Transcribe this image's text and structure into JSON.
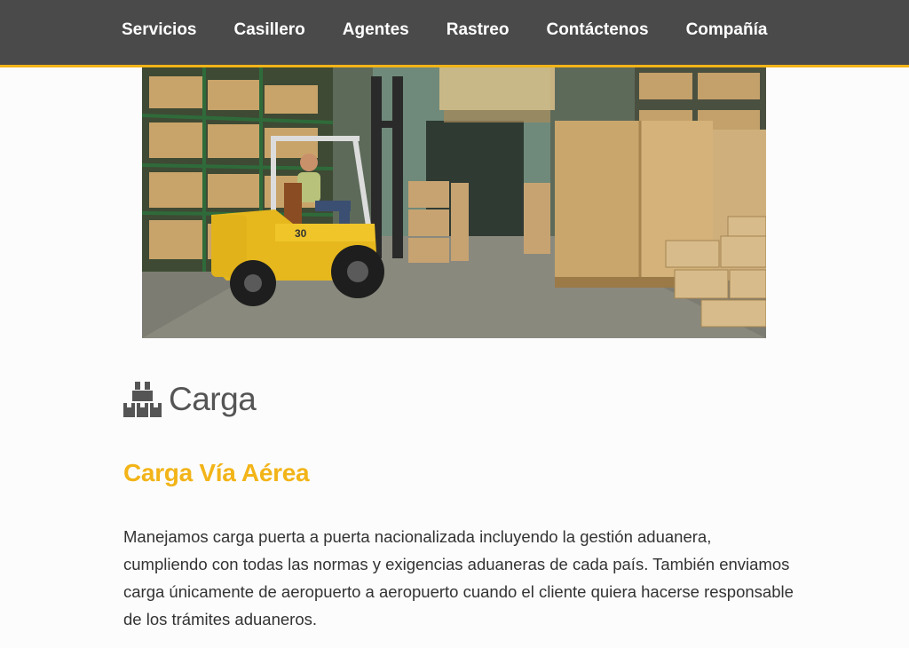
{
  "nav": {
    "items": [
      {
        "label": "Servicios"
      },
      {
        "label": "Casillero"
      },
      {
        "label": "Agentes"
      },
      {
        "label": "Rastreo"
      },
      {
        "label": "Contáctenos"
      },
      {
        "label": "Compañía"
      }
    ]
  },
  "hero": {
    "image_description_icon": "warehouse-forklift-photo",
    "forklift_number": "30"
  },
  "section": {
    "icon": "boxes-icon",
    "title": "Carga"
  },
  "service": {
    "title": "Carga Vía Aérea",
    "description": "Manejamos carga puerta a puerta nacionalizada incluyendo la gestión aduanera, cumpliendo con todas las normas y exigencias aduaneras de cada país. También enviamos carga únicamente de aeropuerto a aeropuerto cuando el cliente quiera hacerse responsable de los trámites aduaneros."
  },
  "colors": {
    "nav_bg": "#4a4a4a",
    "accent": "#f2b418",
    "heading_gray": "#555555",
    "text": "#333333"
  }
}
